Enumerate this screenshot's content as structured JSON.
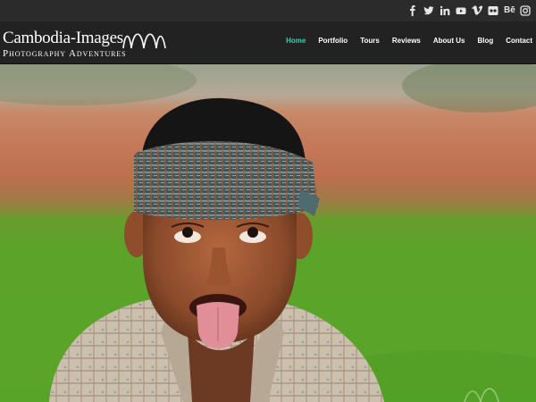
{
  "social": {
    "icons": [
      "facebook-icon",
      "twitter-icon",
      "linkedin-icon",
      "youtube-icon",
      "vimeo-icon",
      "flickr-icon",
      "behance-icon",
      "instagram-icon"
    ],
    "behance_text": "Bē"
  },
  "logo": {
    "title": "Cambodia-Images",
    "subtitle": "Photography Adventures"
  },
  "nav": {
    "items": [
      "Home",
      "Portfolio",
      "Tours",
      "Reviews",
      "About Us",
      "Blog",
      "Contact"
    ],
    "active": "Home",
    "active_color": "#35d1b3"
  },
  "hero": {
    "subject": "hero-photo"
  }
}
